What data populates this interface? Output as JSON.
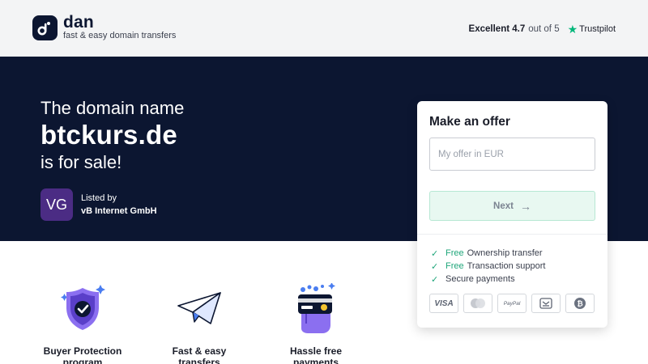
{
  "header": {
    "brand_name": "dan",
    "tagline": "fast & easy domain transfers",
    "rating_label": "Excellent 4.7",
    "rating_suffix": "out of 5",
    "trustpilot_label": "Trustpilot",
    "trustpilot_color": "#00b67a"
  },
  "hero": {
    "line1": "The domain name",
    "domain": "btckurs.de",
    "line3": "is for sale!",
    "seller": {
      "initials": "VG",
      "label": "Listed by",
      "name": "vB Internet GmbH",
      "avatar_color": "#4b2c84"
    },
    "background": "#0c1631"
  },
  "offer": {
    "title": "Make an offer",
    "input_placeholder": "My offer in EUR",
    "input_value": "",
    "next_label": "Next",
    "benefits": [
      {
        "free": "Free",
        "text": "Ownership transfer"
      },
      {
        "free": "Free",
        "text": "Transaction support"
      },
      {
        "free": "",
        "text": "Secure payments"
      }
    ],
    "payment_methods": [
      {
        "name": "visa-icon",
        "label": "VISA"
      },
      {
        "name": "mastercard-icon",
        "label": ""
      },
      {
        "name": "paypal-icon",
        "label": "PayPal"
      },
      {
        "name": "bank-transfer-icon",
        "label": ""
      },
      {
        "name": "bitcoin-icon",
        "label": ""
      }
    ],
    "accent_color": "#1fa67a"
  },
  "features": [
    {
      "icon": "shield-check-icon",
      "line1": "Buyer Protection",
      "line2": "program"
    },
    {
      "icon": "paper-plane-icon",
      "line1": "Fast & easy",
      "line2": "transfers"
    },
    {
      "icon": "card-hand-icon",
      "line1": "Hassle free",
      "line2": "payments"
    }
  ]
}
